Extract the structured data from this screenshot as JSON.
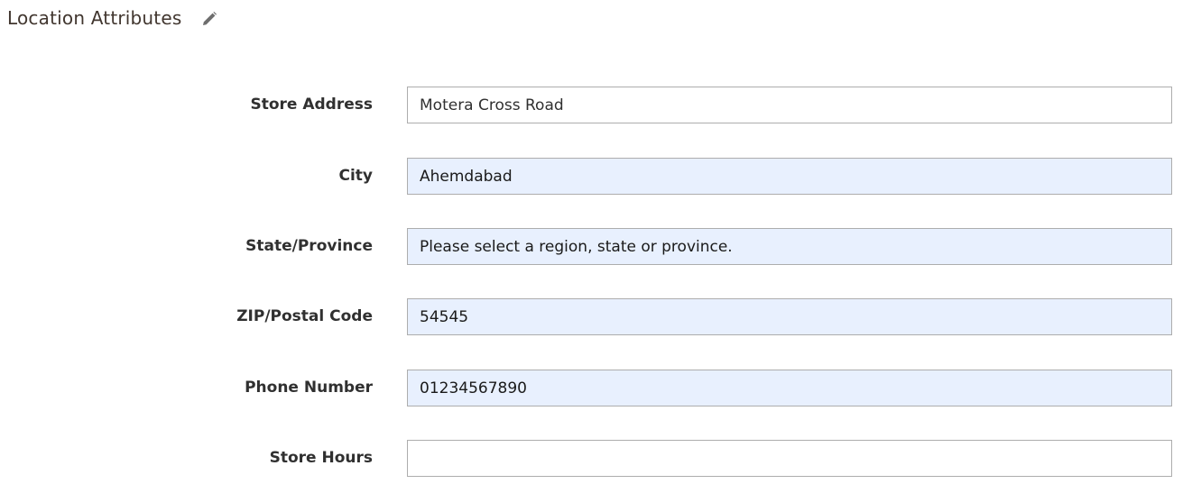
{
  "section": {
    "title": "Location Attributes",
    "edit_icon": "pencil-icon"
  },
  "fields": [
    {
      "label": "Store Address",
      "value": "Motera Cross Road",
      "autofilled": false
    },
    {
      "label": "City",
      "value": "Ahemdabad",
      "autofilled": true
    },
    {
      "label": "State/Province",
      "value": "Please select a region, state or province.",
      "autofilled": true
    },
    {
      "label": "ZIP/Postal Code",
      "value": "54545",
      "autofilled": true
    },
    {
      "label": "Phone Number",
      "value": "01234567890",
      "autofilled": true
    },
    {
      "label": "Store Hours",
      "value": "",
      "autofilled": false
    }
  ],
  "colors": {
    "autofill_bg": "#e8f0fe",
    "border": "#adadad",
    "title": "#41362f",
    "label": "#303030"
  }
}
